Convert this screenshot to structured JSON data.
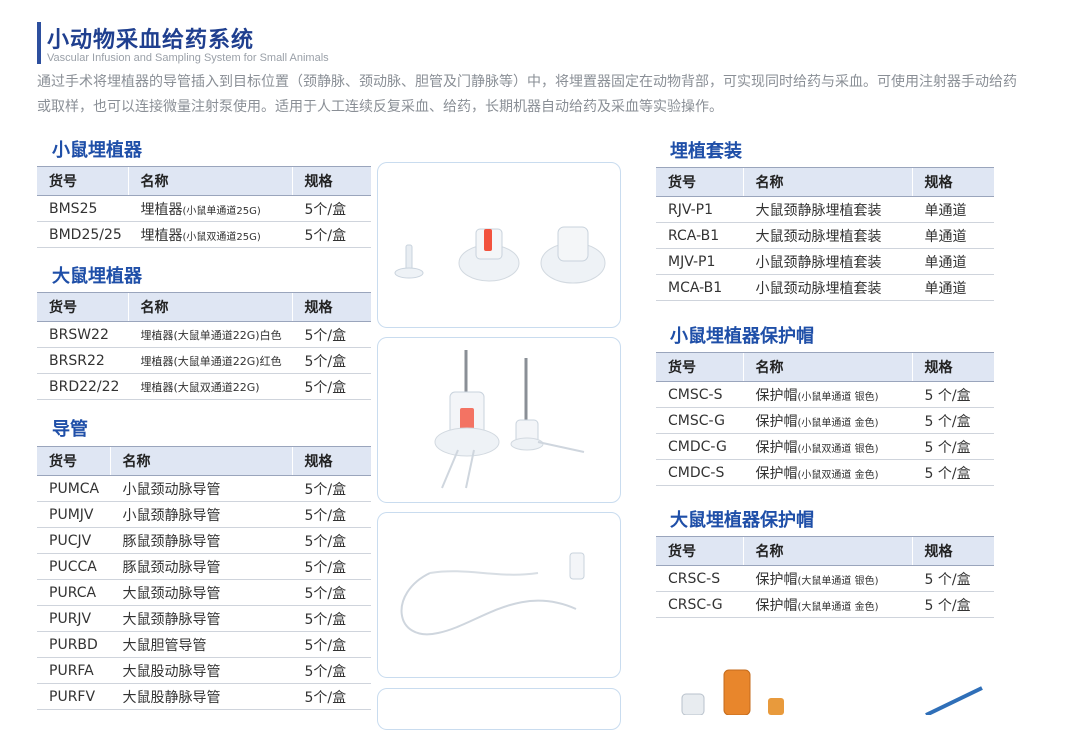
{
  "header": {
    "title": "小动物采血给药系统",
    "subtitle": "Vascular Infusion and Sampling System for Small Animals",
    "intro": "通过手术将埋植器的导管插入到目标位置（颈静脉、颈动脉、胆管及门静脉等）中，将埋置器固定在动物背部，可实现同时给药与采血。可使用注射器手动给药或取样，也可以连接微量注射泵使用。适用于人工连续反复采血、给药，长期机器自动给药及采血等实验操作。"
  },
  "columns": {
    "sku": "货号",
    "name": "名称",
    "spec": "规格"
  },
  "mouse_port": {
    "title": "小鼠埋植器",
    "rows": [
      {
        "sku": "BMS25",
        "name": "埋植器",
        "note": "(小鼠单通道25G)",
        "spec": "5个/盒"
      },
      {
        "sku": "BMD25/25",
        "name": "埋植器",
        "note": "(小鼠双通道25G)",
        "spec": "5个/盒"
      }
    ]
  },
  "rat_port": {
    "title": "大鼠埋植器",
    "rows": [
      {
        "sku": "BRSW22",
        "name": "埋植器(大鼠单通道22G)白色",
        "spec": "5个/盒"
      },
      {
        "sku": "BRSR22",
        "name": "埋植器(大鼠单通道22G)红色",
        "spec": "5个/盒"
      },
      {
        "sku": "BRD22/22",
        "name": "埋植器(大鼠双通道22G)",
        "spec": "5个/盒"
      }
    ]
  },
  "catheter": {
    "title": "导管",
    "rows": [
      {
        "sku": "PUMCA",
        "name": "小鼠颈动脉导管",
        "spec": "5个/盒"
      },
      {
        "sku": "PUMJV",
        "name": "小鼠颈静脉导管",
        "spec": "5个/盒"
      },
      {
        "sku": "PUCJV",
        "name": "豚鼠颈静脉导管",
        "spec": "5个/盒"
      },
      {
        "sku": "PUCCA",
        "name": "豚鼠颈动脉导管",
        "spec": "5个/盒"
      },
      {
        "sku": "PURCA",
        "name": "大鼠颈动脉导管",
        "spec": "5个/盒"
      },
      {
        "sku": "PURJV",
        "name": "大鼠颈静脉导管",
        "spec": "5个/盒"
      },
      {
        "sku": "PURBD",
        "name": "大鼠胆管导管",
        "spec": "5个/盒"
      },
      {
        "sku": "PURFA",
        "name": "大鼠股动脉导管",
        "spec": "5个/盒"
      },
      {
        "sku": "PURFV",
        "name": "大鼠股静脉导管",
        "spec": "5个/盒"
      }
    ]
  },
  "kit": {
    "title": "埋植套装",
    "rows": [
      {
        "sku": "RJV-P1",
        "name": "大鼠颈静脉埋植套装",
        "spec": "单通道"
      },
      {
        "sku": "RCA-B1",
        "name": "大鼠颈动脉埋植套装",
        "spec": "单通道"
      },
      {
        "sku": "MJV-P1",
        "name": "小鼠颈静脉埋植套装",
        "spec": "单通道"
      },
      {
        "sku": "MCA-B1",
        "name": "小鼠颈动脉埋植套装",
        "spec": "单通道"
      }
    ]
  },
  "mouse_cap": {
    "title": "小鼠埋植器保护帽",
    "rows": [
      {
        "sku": "CMSC-S",
        "name": "保护帽",
        "note": "(小鼠单通道 银色)",
        "spec": "5 个/盒"
      },
      {
        "sku": "CMSC-G",
        "name": "保护帽",
        "note": "(小鼠单通道 金色)",
        "spec": "5 个/盒"
      },
      {
        "sku": "CMDC-G",
        "name": "保护帽",
        "note": "(小鼠双通道 银色)",
        "spec": "5 个/盒"
      },
      {
        "sku": "CMDC-S",
        "name": "保护帽",
        "note": "(小鼠双通道 金色)",
        "spec": "5 个/盒"
      }
    ]
  },
  "rat_cap": {
    "title": "大鼠埋植器保护帽",
    "rows": [
      {
        "sku": "CRSC-S",
        "name": "保护帽",
        "note": "(大鼠单通道 银色)",
        "spec": "5 个/盒"
      },
      {
        "sku": "CRSC-G",
        "name": "保护帽",
        "note": "(大鼠单通道 金色)",
        "spec": "5 个/盒"
      }
    ]
  },
  "colors": {
    "title": "#1f3f8f",
    "section": "#1f4fa8",
    "header_row": "#dfe6f3",
    "photo_border": "#c9dcef"
  }
}
